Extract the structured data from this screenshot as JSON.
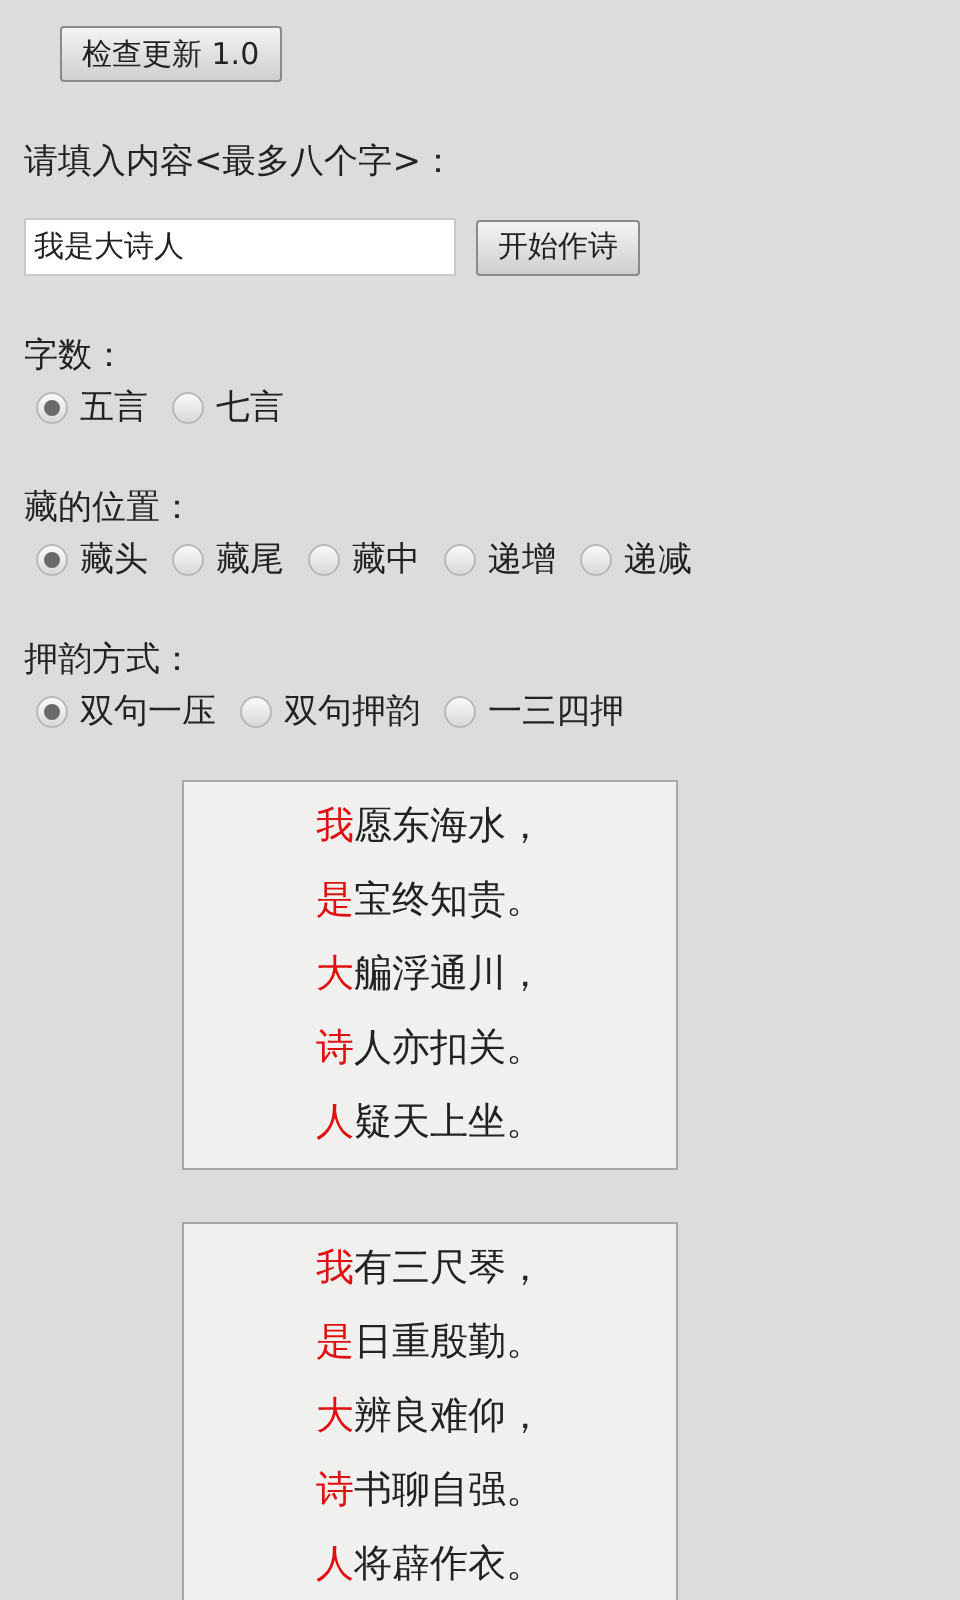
{
  "update_button": "检查更新 1.0",
  "input_label": "请填入内容<最多八个字>：",
  "input": {
    "value": "我是大诗人"
  },
  "start_button": "开始作诗",
  "groups": [
    {
      "label": "字数：",
      "options": [
        {
          "label": "五言",
          "selected": true
        },
        {
          "label": "七言",
          "selected": false
        }
      ]
    },
    {
      "label": "藏的位置：",
      "options": [
        {
          "label": "藏头",
          "selected": true
        },
        {
          "label": "藏尾",
          "selected": false
        },
        {
          "label": "藏中",
          "selected": false
        },
        {
          "label": "递增",
          "selected": false
        },
        {
          "label": "递减",
          "selected": false
        }
      ]
    },
    {
      "label": "押韵方式：",
      "options": [
        {
          "label": "双句一压",
          "selected": true
        },
        {
          "label": "双句押韵",
          "selected": false
        },
        {
          "label": "一三四押",
          "selected": false
        }
      ]
    }
  ],
  "poems": [
    {
      "lines": [
        {
          "head": "我",
          "rest": "愿东海水，"
        },
        {
          "head": "是",
          "rest": "宝终知贵。"
        },
        {
          "head": "大",
          "rest": "艑浮通川，"
        },
        {
          "head": "诗",
          "rest": "人亦扣关。"
        },
        {
          "head": "人",
          "rest": "疑天上坐。"
        }
      ]
    },
    {
      "lines": [
        {
          "head": "我",
          "rest": "有三尺琴，"
        },
        {
          "head": "是",
          "rest": "日重殷勤。"
        },
        {
          "head": "大",
          "rest": "辨良难仰，"
        },
        {
          "head": "诗",
          "rest": "书聊自强。"
        },
        {
          "head": "人",
          "rest": "将薜作衣。"
        }
      ]
    }
  ]
}
